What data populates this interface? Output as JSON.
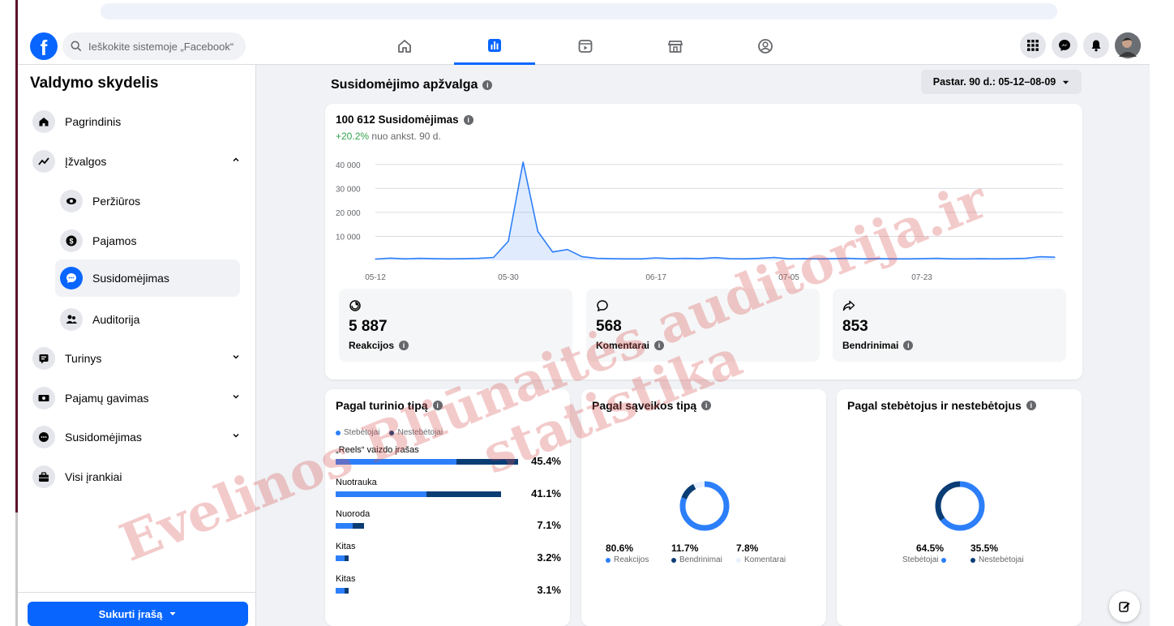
{
  "topbar": {
    "search_placeholder": "Ieškokite sistemoje „Facebook“",
    "logo_letter": "f"
  },
  "sidebar": {
    "title": "Valdymo skydelis",
    "items": [
      {
        "label": "Pagrindinis",
        "icon": "home-icon"
      },
      {
        "label": "Įžvalgos",
        "icon": "trend-icon",
        "expanded": true
      },
      {
        "label": "Peržiūros",
        "icon": "eye-icon",
        "sub": true
      },
      {
        "label": "Pajamos",
        "icon": "dollar-icon",
        "sub": true
      },
      {
        "label": "Susidomėjimas",
        "icon": "chat-bubble-icon",
        "sub": true,
        "selected": true
      },
      {
        "label": "Auditorija",
        "icon": "people-icon",
        "sub": true
      },
      {
        "label": "Turinys",
        "icon": "content-icon"
      },
      {
        "label": "Pajamų gavimas",
        "icon": "money-icon"
      },
      {
        "label": "Susidomėjimas",
        "icon": "chat-icon"
      },
      {
        "label": "Visi įrankiai",
        "icon": "briefcase-icon"
      }
    ],
    "create_button": "Sukurti įrašą"
  },
  "main": {
    "section_title": "Susidomėjimo apžvalga",
    "date_range": "Pastar. 90 d.: 05-12–08-09",
    "overview": {
      "total": "100 612 Susidomėjimas",
      "change": "+20.2%",
      "change_text": "nuo ankst. 90 d."
    },
    "stats": [
      {
        "value": "5 887",
        "label": "Reakcijos",
        "icon": "reaction-icon"
      },
      {
        "value": "568",
        "label": "Komentarai",
        "icon": "comment-icon"
      },
      {
        "value": "853",
        "label": "Bendrinimai",
        "icon": "share-icon"
      }
    ],
    "content_type": {
      "title": "Pagal turinio tipą",
      "legend": [
        "Stebėtojai",
        "Nestebėtojai"
      ],
      "rows": [
        {
          "label": "„Reels“ vaizdo įrašas",
          "pct": "45.4%",
          "followers": 0.66,
          "nonfollowers": 0.34,
          "total": 0.454
        },
        {
          "label": "Nuotrauka",
          "pct": "41.1%",
          "followers": 0.55,
          "nonfollowers": 0.45,
          "total": 0.411
        },
        {
          "label": "Nuoroda",
          "pct": "7.1%",
          "followers": 0.6,
          "nonfollowers": 0.4,
          "total": 0.071
        },
        {
          "label": "Kitas",
          "pct": "3.2%",
          "followers": 0.7,
          "nonfollowers": 0.3,
          "total": 0.032
        },
        {
          "label": "Kitas",
          "pct": "3.1%",
          "followers": 0.7,
          "nonfollowers": 0.3,
          "total": 0.031
        }
      ]
    },
    "interaction_type": {
      "title": "Pagal sąveikos tipą",
      "items": [
        {
          "value": "80.6%",
          "label": "Reakcijos",
          "color": "#2d7ff9"
        },
        {
          "value": "11.7%",
          "label": "Bendrinimai",
          "color": "#0b3d75"
        },
        {
          "value": "7.8%",
          "label": "Komentarai",
          "color": "#e8f1fd"
        }
      ]
    },
    "followers": {
      "title": "Pagal stebėtojus ir nestebėtojus",
      "items": [
        {
          "value": "64.5%",
          "label": "Stebėtojai",
          "color": "#2d7ff9"
        },
        {
          "value": "35.5%",
          "label": "Nestebėtojai",
          "color": "#0b3d75"
        }
      ]
    }
  },
  "chart_data": {
    "type": "line",
    "title": "100 612 Susidomėjimas",
    "yticks": [
      "40 000",
      "30 000",
      "20 000",
      "10 000"
    ],
    "xticks": [
      "05-12",
      "05-30",
      "06-17",
      "07-05",
      "07-23"
    ],
    "ylim": [
      0,
      45000
    ],
    "x": [
      "05-12",
      "05-14",
      "05-16",
      "05-18",
      "05-20",
      "05-22",
      "05-24",
      "05-26",
      "05-28",
      "05-30",
      "05-31",
      "06-01",
      "06-03",
      "06-05",
      "06-07",
      "06-09",
      "06-11",
      "06-13",
      "06-15",
      "06-17",
      "06-19",
      "06-21",
      "06-23",
      "06-25",
      "06-27",
      "06-29",
      "07-01",
      "07-03",
      "07-05",
      "07-07",
      "07-09",
      "07-11",
      "07-13",
      "07-15",
      "07-17",
      "07-19",
      "07-21",
      "07-23",
      "07-25",
      "07-27",
      "07-29",
      "07-31",
      "08-02",
      "08-04",
      "08-06",
      "08-08",
      "08-09"
    ],
    "values": [
      500,
      900,
      600,
      800,
      700,
      600,
      700,
      800,
      1200,
      8000,
      41000,
      12000,
      3500,
      4500,
      1500,
      800,
      700,
      600,
      600,
      1000,
      700,
      800,
      700,
      1100,
      700,
      600,
      800,
      1200,
      600,
      700,
      600,
      700,
      800,
      600,
      700,
      600,
      600,
      700,
      800,
      600,
      600,
      700,
      600,
      700,
      800,
      1500,
      1300
    ],
    "grid": true,
    "fill": true,
    "color": "#2d7ff9"
  },
  "watermark": {
    "line1": "Evelinos Bliūnaitės auditorija.ir",
    "line2": "statistika"
  },
  "colors": {
    "brand": "#0866ff",
    "followers": "#2d7ff9",
    "nonfollowers": "#0b3d75",
    "positive": "#31a24c"
  }
}
